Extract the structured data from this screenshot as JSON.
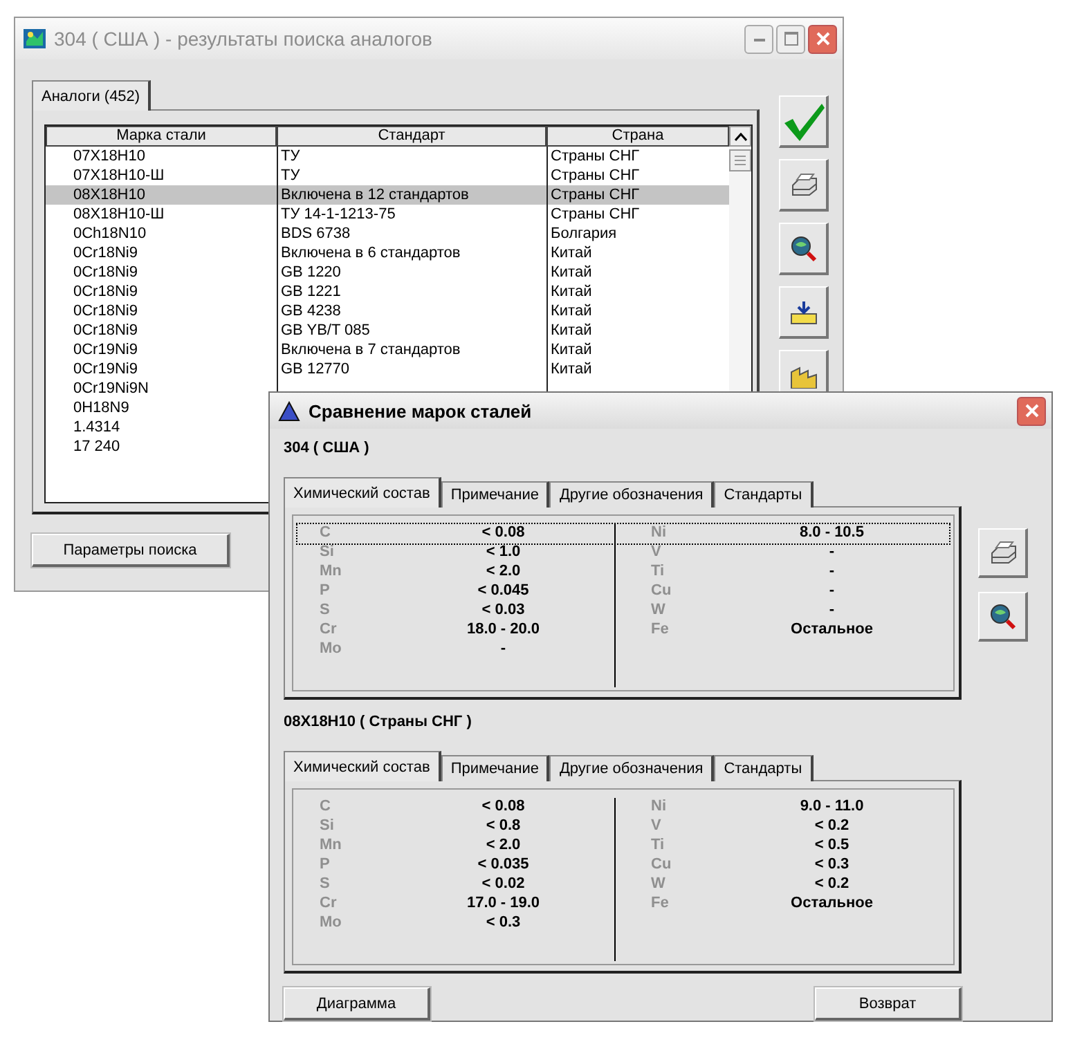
{
  "analogs_window": {
    "title": "304 ( США ) - результаты поиска аналогов",
    "tabs": [
      {
        "label": "Аналоги (452)",
        "selected": true
      }
    ],
    "table": {
      "columns": [
        "Марка стали",
        "Стандарт",
        "Страна"
      ],
      "rows": [
        {
          "cells": [
            "07X18H10",
            "ТУ",
            "Страны СНГ"
          ],
          "selected": false
        },
        {
          "cells": [
            "07X18H10-Ш",
            "ТУ",
            "Страны СНГ"
          ],
          "selected": false
        },
        {
          "cells": [
            "08X18H10",
            "Включена в 12 стандартов",
            "Страны СНГ"
          ],
          "selected": true
        },
        {
          "cells": [
            "08X18H10-Ш",
            "ТУ 14-1-1213-75",
            "Страны СНГ"
          ],
          "selected": false
        },
        {
          "cells": [
            "0Ch18N10",
            "BDS 6738",
            "Болгария"
          ],
          "selected": false
        },
        {
          "cells": [
            "0Cr18Ni9",
            "Включена в 6 стандартов",
            "Китай"
          ],
          "selected": false
        },
        {
          "cells": [
            "0Cr18Ni9",
            "GB 1220",
            "Китай"
          ],
          "selected": false
        },
        {
          "cells": [
            "0Cr18Ni9",
            "GB 1221",
            "Китай"
          ],
          "selected": false
        },
        {
          "cells": [
            "0Cr18Ni9",
            "GB 4238",
            "Китай"
          ],
          "selected": false
        },
        {
          "cells": [
            "0Cr18Ni9",
            "GB YB/T 085",
            "Китай"
          ],
          "selected": false
        },
        {
          "cells": [
            "0Cr19Ni9",
            "Включена в 7 стандартов",
            "Китай"
          ],
          "selected": false
        },
        {
          "cells": [
            "0Cr19Ni9",
            "GB 12770",
            "Китай"
          ],
          "selected": false
        },
        {
          "cells": [
            "0Cr19Ni9N"
          ],
          "selected": false
        },
        {
          "cells": [
            "0H18N9"
          ],
          "selected": false
        },
        {
          "cells": [
            "1.4314"
          ],
          "selected": false
        },
        {
          "cells": [
            "17 240"
          ],
          "selected": false
        }
      ]
    },
    "button": "Параметры поиска"
  },
  "compare_window": {
    "title": "Сравнение марок сталей",
    "sections": [
      {
        "heading": "304 ( США )",
        "tabs": [
          {
            "label": "Химический состав",
            "selected": true
          },
          {
            "label": "Примечание",
            "selected": false
          },
          {
            "label": "Другие обозначения",
            "selected": false
          },
          {
            "label": "Стандарты",
            "selected": false
          }
        ],
        "rows": [
          {
            "element": "C",
            "value": "< 0.08",
            "element_2": "Ni",
            "value_2": "8.0 - 10.5",
            "selected": true
          },
          {
            "element": "Si",
            "value": "< 1.0",
            "element_2": "V",
            "value_2": "-",
            "selected": false
          },
          {
            "element": "Mn",
            "value": "< 2.0",
            "element_2": "Ti",
            "value_2": "-",
            "selected": false
          },
          {
            "element": "P",
            "value": "< 0.045",
            "element_2": "Cu",
            "value_2": "-",
            "selected": false
          },
          {
            "element": "S",
            "value": "< 0.03",
            "element_2": "W",
            "value_2": "-",
            "selected": false
          },
          {
            "element": "Cr",
            "value": "18.0 - 20.0",
            "element_2": "Fe",
            "value_2": "Остальное",
            "selected": false
          },
          {
            "element": "Mo",
            "value": "-",
            "selected": false
          }
        ]
      },
      {
        "heading": "08X18H10 ( Страны СНГ )",
        "tabs": [
          {
            "label": "Химический состав",
            "selected": true
          },
          {
            "label": "Примечание",
            "selected": false
          },
          {
            "label": "Другие обозначения",
            "selected": false
          },
          {
            "label": "Стандарты",
            "selected": false
          }
        ],
        "rows": [
          {
            "element": "C",
            "value": "< 0.08",
            "element_2": "Ni",
            "value_2": "9.0 - 11.0",
            "selected": false
          },
          {
            "element": "Si",
            "value": "< 0.8",
            "element_2": "V",
            "value_2": "< 0.2",
            "selected": false
          },
          {
            "element": "Mn",
            "value": "< 2.0",
            "element_2": "Ti",
            "value_2": "< 0.5",
            "selected": false
          },
          {
            "element": "P",
            "value": "< 0.035",
            "element_2": "Cu",
            "value_2": "< 0.3",
            "selected": false
          },
          {
            "element": "S",
            "value": "< 0.02",
            "element_2": "W",
            "value_2": "< 0.2",
            "selected": false
          },
          {
            "element": "Cr",
            "value": "17.0 - 19.0",
            "element_2": "Fe",
            "value_2": "Остальное",
            "selected": false
          },
          {
            "element": "Mo",
            "value": "< 0.3",
            "selected": false
          }
        ]
      }
    ],
    "buttons": [
      "Диаграмма",
      "Возврат"
    ]
  }
}
